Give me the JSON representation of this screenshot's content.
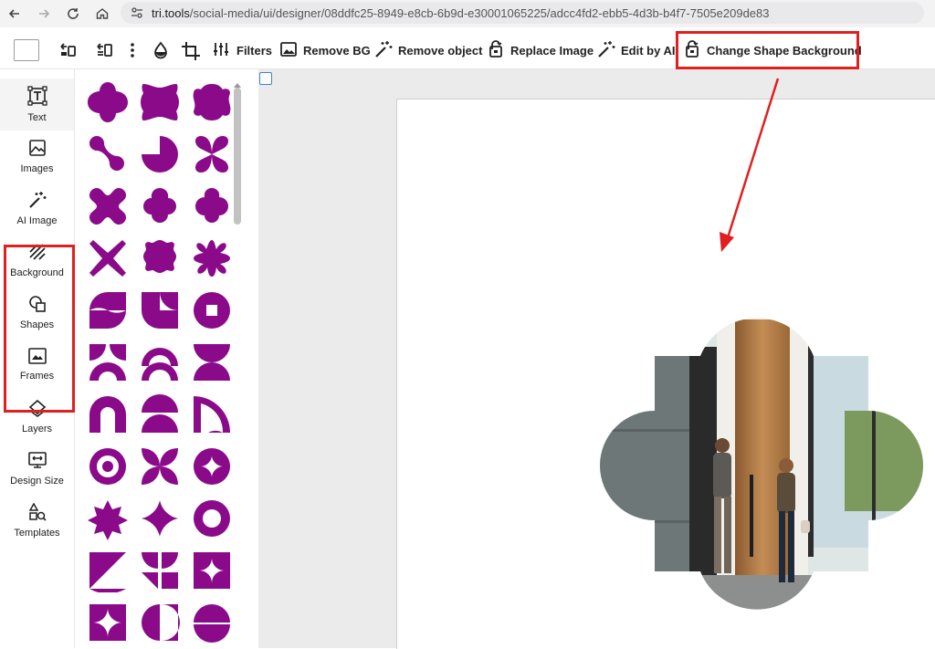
{
  "browser": {
    "url_host": "tri.tools",
    "url_path": "/social-media/ui/designer/08ddfc25-8949-e8cb-6b9d-e30001065225/adcc4fd2-ebb5-4d3b-b4f7-7505e209de83",
    "icons": [
      "back-arrow-icon",
      "forward-arrow-icon",
      "reload-icon",
      "home-icon",
      "site-settings-icon"
    ]
  },
  "toolbar": {
    "filters": "Filters",
    "remove_bg": "Remove BG",
    "remove_object": "Remove object",
    "replace_image": "Replace Image",
    "edit_by_ai": "Edit by AI",
    "change_shape_background": "Change Shape Background"
  },
  "sidebar": {
    "items": [
      {
        "label": "Text",
        "icon": "text-box-icon"
      },
      {
        "label": "Images",
        "icon": "image-icon"
      },
      {
        "label": "AI Image",
        "icon": "magic-wand-icon"
      },
      {
        "label": "Background",
        "icon": "hatch-icon"
      },
      {
        "label": "Shapes",
        "icon": "shapes-icon"
      },
      {
        "label": "Frames",
        "icon": "frame-icon"
      },
      {
        "label": "Layers",
        "icon": "layers-icon"
      },
      {
        "label": "Design Size",
        "icon": "design-size-icon"
      },
      {
        "label": "Templates",
        "icon": "templates-icon"
      }
    ]
  },
  "colors": {
    "shape_fill": "#8a0a8a",
    "highlight": "#e02020",
    "canvas_bg": "#ebebeb"
  }
}
